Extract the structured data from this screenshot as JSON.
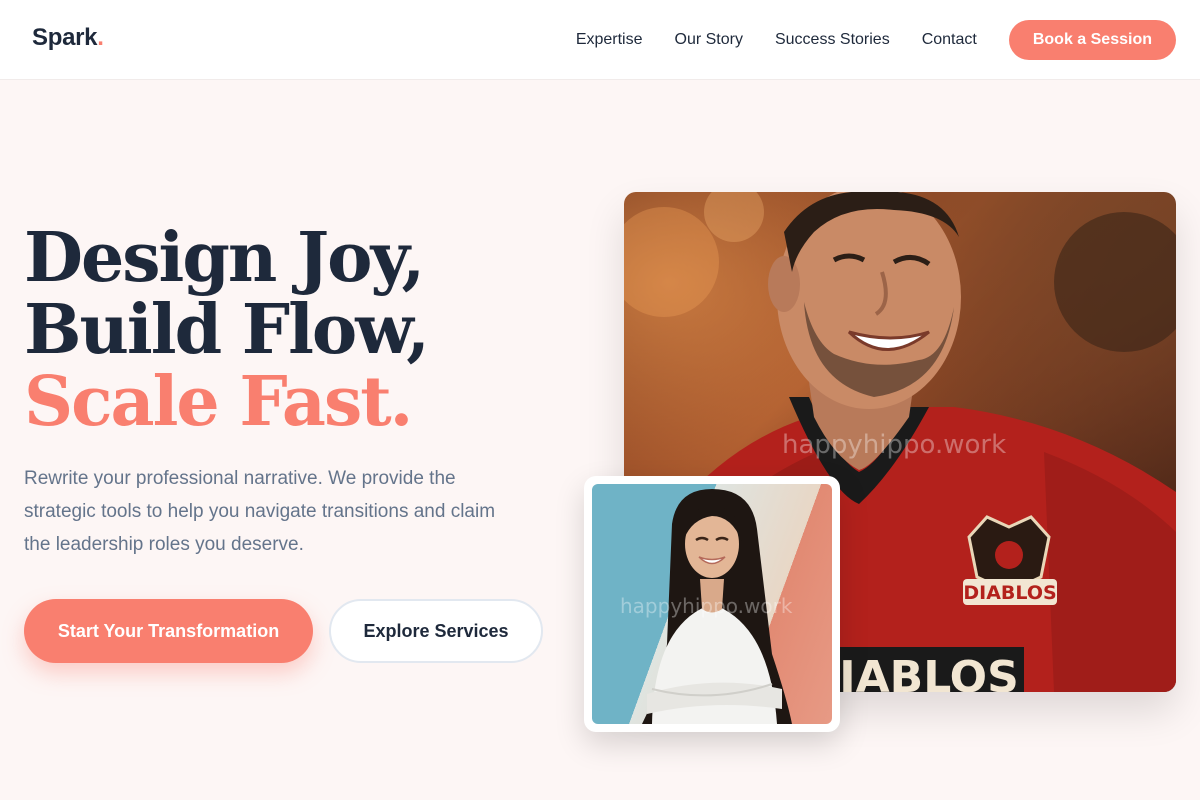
{
  "header": {
    "logo_text": "Spark",
    "logo_dot": ".",
    "nav": [
      {
        "label": "Expertise"
      },
      {
        "label": "Our Story"
      },
      {
        "label": "Success Stories"
      },
      {
        "label": "Contact"
      }
    ],
    "cta_label": "Book a Session"
  },
  "hero": {
    "headline_line1": "Design Joy,",
    "headline_line2": "Build Flow,",
    "headline_line3": "Scale Fast.",
    "subtext": "Rewrite your professional narrative. We provide the strategic tools to help you navigate transitions and claim the leadership roles you deserve.",
    "primary_button": "Start Your Transformation",
    "secondary_button": "Explore Services"
  },
  "images": {
    "main_watermark": "happyhippo.work",
    "inset_watermark": "happyhippo.work",
    "jersey_logo_text": "DIABLOS",
    "jersey_bottom_text": "IABLOS"
  },
  "colors": {
    "accent": "#f97f6f",
    "dark": "#1e293b",
    "muted": "#64748b",
    "background": "#fdf6f5"
  }
}
